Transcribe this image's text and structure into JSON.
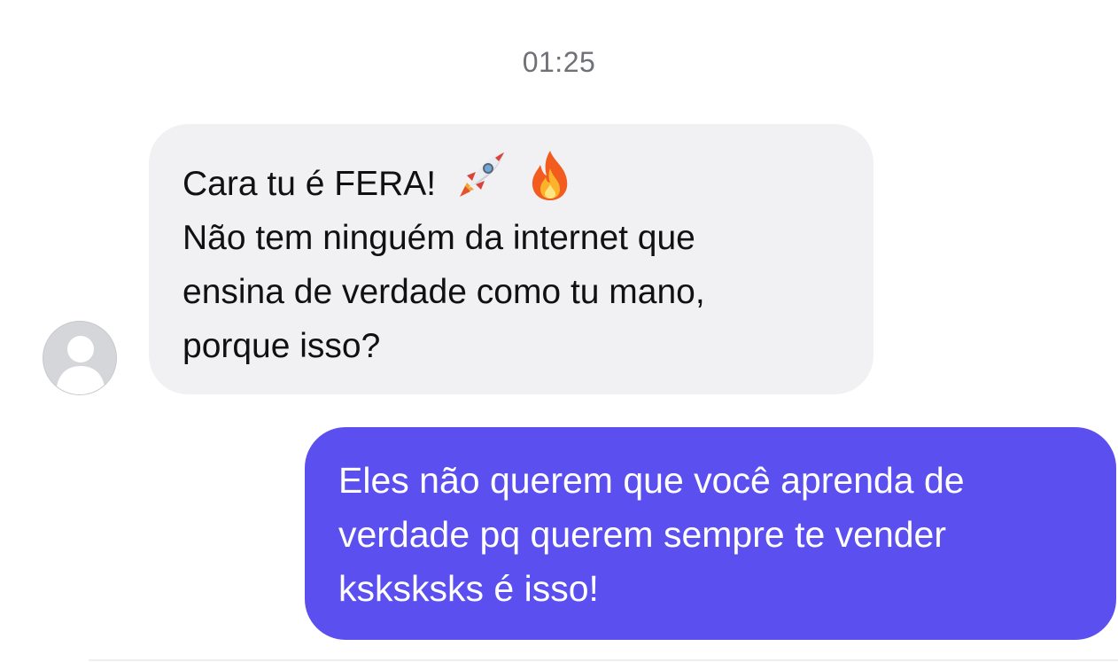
{
  "chat": {
    "timestamp": "01:25",
    "incoming": {
      "line1": "Cara tu é FERA!",
      "emojis": [
        "rocket-emoji",
        "fire-emoji"
      ],
      "line2": "Não tem ninguém da internet que",
      "line3": "ensina de verdade como tu mano,",
      "line4": "porque isso?"
    },
    "outgoing": {
      "line1": "Eles não querem que você aprenda de",
      "line2": "verdade pq querem sempre te vender",
      "line3": "ksksksks é isso!"
    }
  },
  "colors": {
    "incoming_bubble": "#f1f1f4",
    "outgoing_bubble": "#5b50ef",
    "timestamp_text": "#6f7177",
    "avatar_bg": "#d5d6da"
  }
}
